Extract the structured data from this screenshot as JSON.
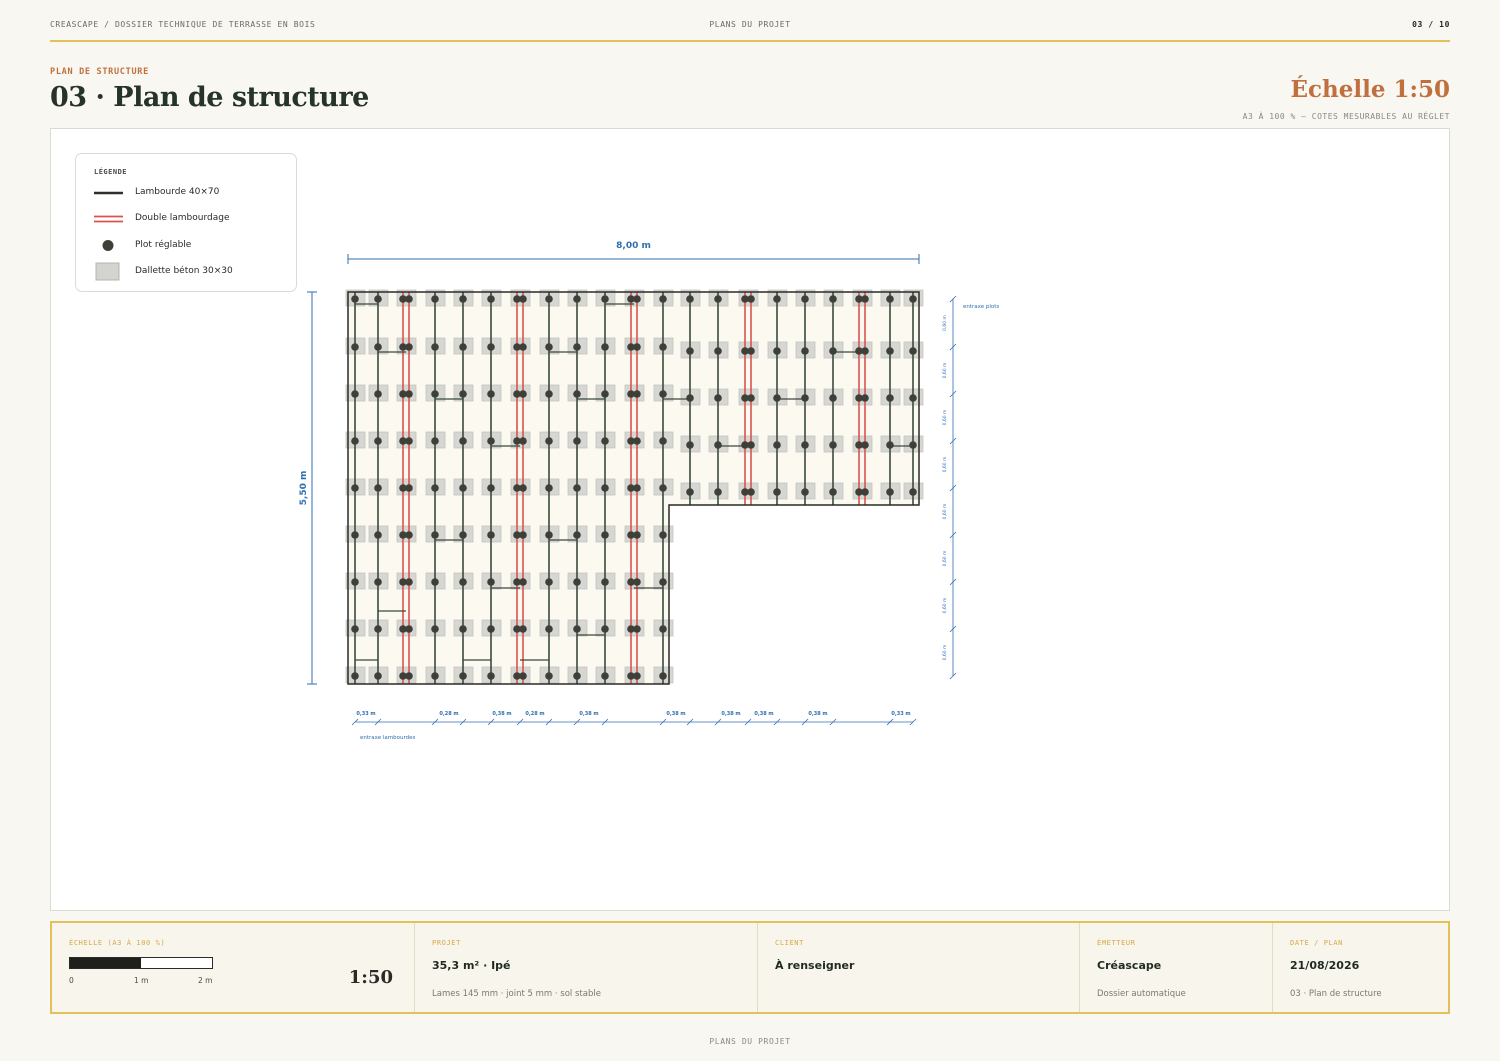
{
  "header": {
    "breadcrumb": "CREASCAPE  /  DOSSIER TECHNIQUE DE TERRASSE EN BOIS",
    "section": "PLANS DU PROJET",
    "page": "03 / 10"
  },
  "title": {
    "eyebrow": "PLAN DE STRUCTURE",
    "main": "03 · Plan de structure",
    "scale": "Échelle 1:50",
    "scale_note": "A3 À 100 % — COTES MESURABLES AU RÉGLET"
  },
  "legend": {
    "title": "LÉGENDE",
    "items": [
      {
        "label": "Lambourde 40×70",
        "symbol": "joist",
        "color": "#2f2f2a"
      },
      {
        "label": "Double lambourdage",
        "symbol": "double-joist",
        "color": "#d9534f"
      },
      {
        "label": "Plot réglable",
        "symbol": "pad",
        "color": "#3f3f3a"
      },
      {
        "label": "Dallette béton 30×30",
        "symbol": "slab",
        "color": "#d3d4cf"
      }
    ]
  },
  "plan": {
    "width_label": "8,00 m",
    "height_label": "5,50 m",
    "joist_spacing_label": "entraxe lambourdes",
    "pad_spacing_label": "entraxe plots",
    "bottom_dims": [
      "0,33 m",
      "0,28 m",
      "0,38 m",
      "0,28 m",
      "0,38 m",
      "0,38 m",
      "0,38 m",
      "0,38 m",
      "0,38 m",
      "0,33 m"
    ],
    "side_dims": [
      "0,60 m",
      "0,60 m",
      "0,60 m",
      "0,60 m",
      "0,60 m",
      "0,60 m",
      "0,60 m",
      "0,60 m"
    ],
    "colors": {
      "dimension": "#2f6fb0",
      "deck": "#fbf9f0",
      "outline": "#2a2a26",
      "joist": "#3a4a3c",
      "double": "#d9534f"
    }
  },
  "title_block": {
    "scale_label": "ÉCHELLE (A3 À 100 %)",
    "scale_ticks": [
      "0",
      "1 m",
      "2 m"
    ],
    "scale_ratio": "1:50",
    "project_label": "PROJET",
    "project_main": "35,3 m² · Ipé",
    "project_sub": "Lames 145 mm · joint 5 mm · sol stable",
    "client_label": "CLIENT",
    "client_main": "À renseigner",
    "issuer_label": "ÉMETTEUR",
    "issuer_main": "Créascape",
    "issuer_sub": "Dossier automatique",
    "date_label": "DATE / PLAN",
    "date_main": "21/08/2026",
    "date_sub": "03 · Plan de structure"
  },
  "footer": "PLANS DU PROJET"
}
